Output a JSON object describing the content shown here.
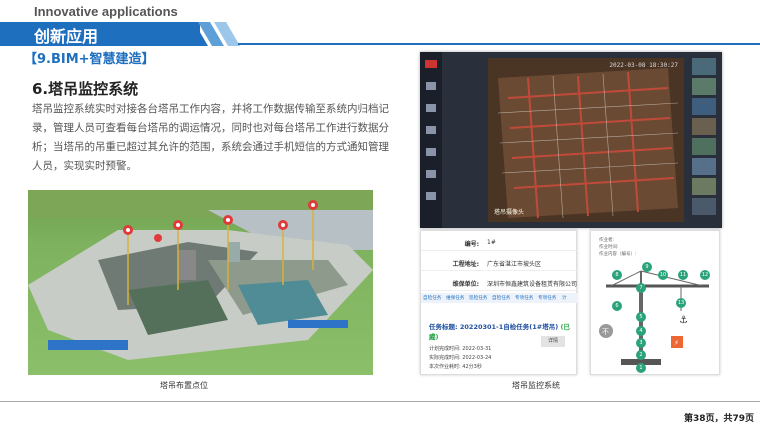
{
  "header": {
    "top_title": "Innovative applications",
    "bar_title": "创新应用",
    "subtitle": "【9.BIM+智慧建造】"
  },
  "section": {
    "title": "6.塔吊监控系统",
    "body": "塔吊监控系统实时对接各台塔吊工作内容，并将工作数据传输至系统内归档记录，管理人员可查看每台塔吊的调运情况，同时也对每台塔吊工作进行数据分析；当塔吊的吊重已超过其允许的范围，系统会通过手机短信的方式通知管理人员，实现实时预警。"
  },
  "captions": {
    "left": "塔吊布置点位",
    "right": "塔吊监控系统"
  },
  "monitor": {
    "timestamp": "2022-03-08 18:30:27",
    "camera_label": "塔吊摄像头"
  },
  "task_panel": {
    "rows": [
      {
        "label": "编号:",
        "value": "1#"
      },
      {
        "label": "工程地址:",
        "value": "广东省湛江市坡头区"
      },
      {
        "label": "维保单位:",
        "value": "深圳市恒鑫建筑设备租赁有限公司"
      }
    ],
    "tabs": [
      "自检任务",
      "维保任务",
      "巡检任务",
      "自检任务",
      "专项任务",
      "专项任务",
      "计"
    ],
    "task_title_prefix": "任务标题:",
    "task_title": "20220301-1自检任务(1#塔吊)",
    "task_status": "(已完",
    "task_status_end": "成)",
    "meta": [
      "计划完成时间:  2022-03-31",
      "实际完成时间:  2022-03-24",
      "本次作业耗时:  42分3秒"
    ],
    "button_label": "详情"
  },
  "diagram": {
    "lines": [
      "作业者:",
      "作业时间:",
      "作业内容（编号）:"
    ],
    "markers": [
      "8",
      "9",
      "10",
      "11",
      "12",
      "7",
      "13",
      "6",
      "5",
      "4",
      "3",
      "2",
      "1"
    ]
  },
  "footer": {
    "page": "第38页，共79页"
  }
}
